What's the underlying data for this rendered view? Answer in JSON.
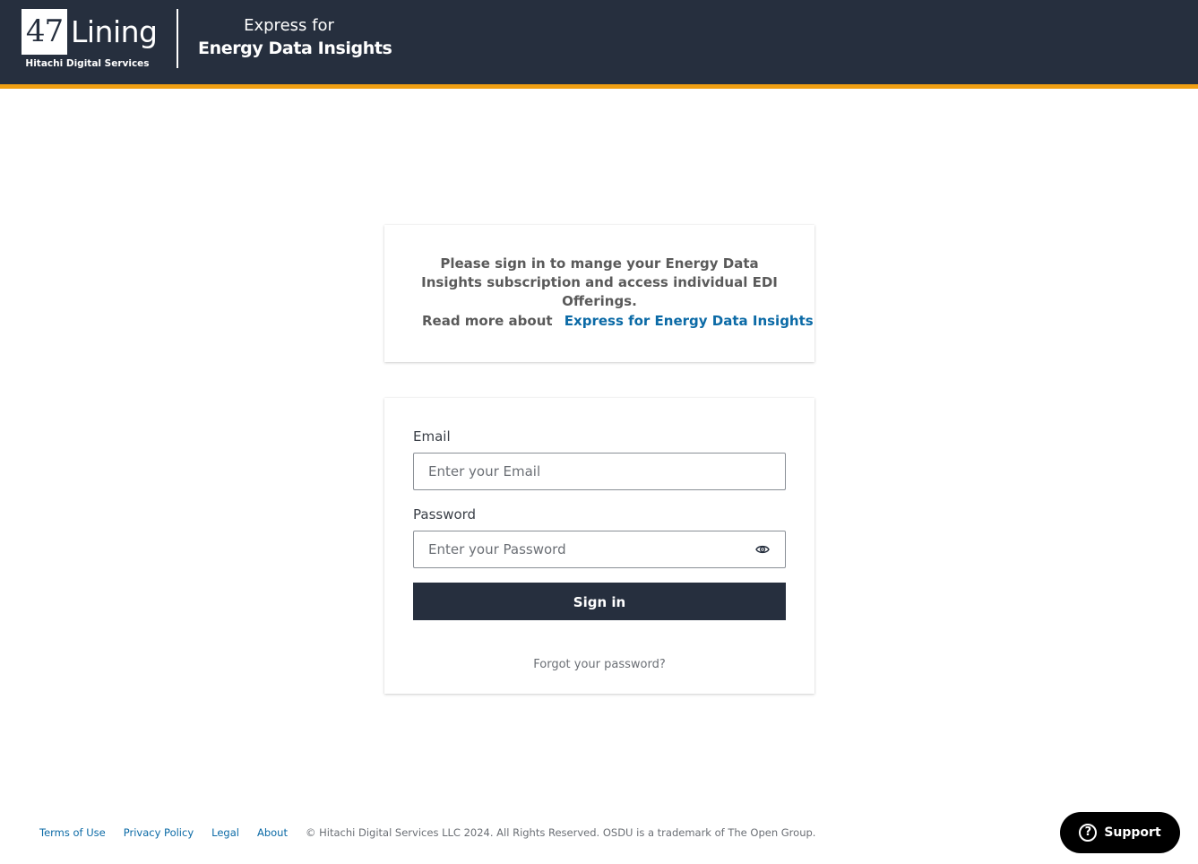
{
  "header": {
    "logo_number": "47",
    "logo_word": "Lining",
    "logo_subtitle": "Hitachi Digital Services",
    "product_prefix": "Express for",
    "product_name": "Energy Data Insights",
    "background_color": "#262f3e",
    "accent_color": "#f09f12"
  },
  "info_card": {
    "message": "Please sign in to mange your Energy Data Insights subscription and access individual EDI Offerings.",
    "read_more_label": "Read more about",
    "read_more_link": "Express for Energy Data Insights"
  },
  "login": {
    "email_label": "Email",
    "email_placeholder": "Enter your Email",
    "email_value": "",
    "password_label": "Password",
    "password_placeholder": "Enter your Password",
    "password_value": "",
    "reveal_icon": "eye-icon",
    "sign_in_label": "Sign in",
    "forgot_link": "Forgot your password?"
  },
  "footer": {
    "links": [
      "Terms of Use",
      "Privacy Policy",
      "Legal",
      "About"
    ],
    "copyright": "© Hitachi Digital Services LLC 2024. All Rights Reserved. OSDU is a trademark of The Open Group."
  },
  "support": {
    "icon": "question-icon",
    "icon_glyph": "?",
    "label": "Support"
  },
  "colors": {
    "link": "#0b6aa6",
    "button": "#262f3e"
  }
}
